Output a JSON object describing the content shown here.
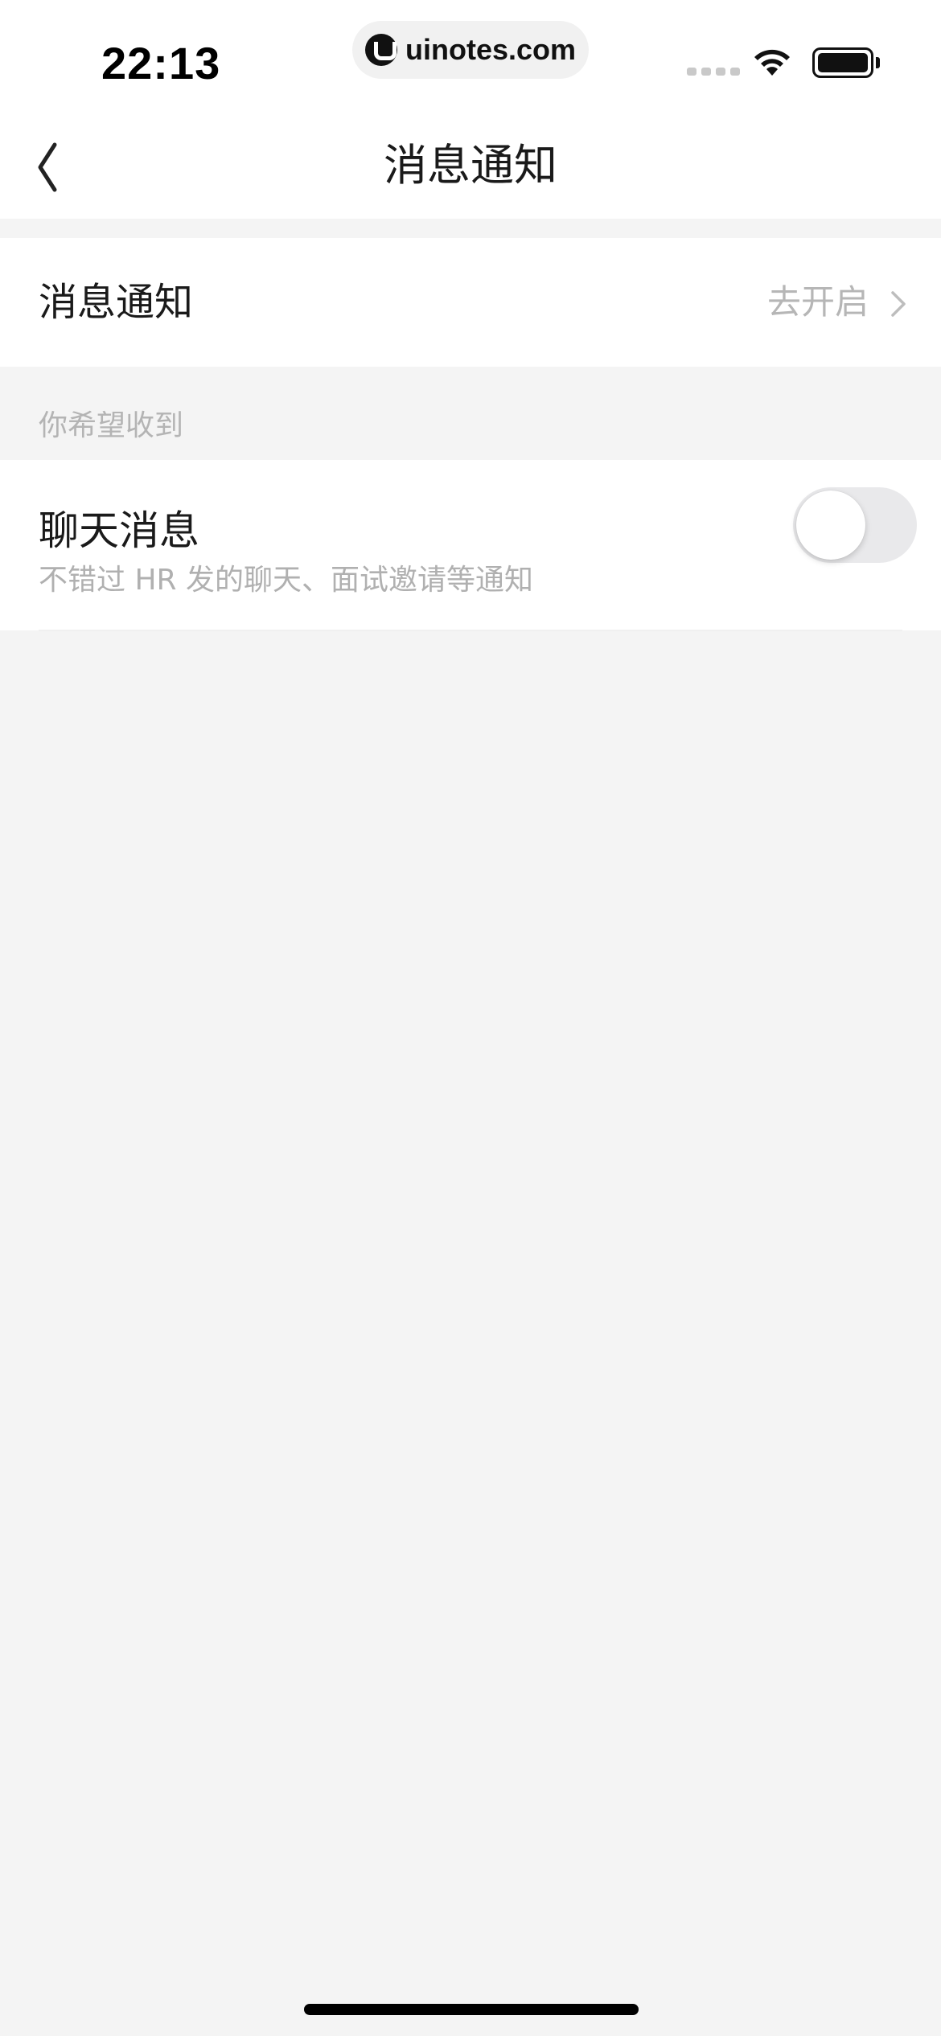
{
  "status_bar": {
    "time": "22:13",
    "url": "uinotes.com",
    "icons": [
      "signal-icon",
      "wifi-icon",
      "battery-icon"
    ]
  },
  "nav": {
    "title": "消息通知",
    "back_icon": "chevron-left-icon"
  },
  "notify_row": {
    "label": "消息通知",
    "action": "去开启",
    "icon": "chevron-right-icon"
  },
  "section": {
    "header": "你希望收到"
  },
  "chat_setting": {
    "title": "聊天消息",
    "description": "不错过 HR 发的聊天、面试邀请等通知",
    "enabled": false
  },
  "colors": {
    "background": "#f4f4f4",
    "surface": "#ffffff",
    "text_primary": "#1a1a1a",
    "text_secondary": "#b0b0b0",
    "toggle_off": "#e9e9eb"
  }
}
